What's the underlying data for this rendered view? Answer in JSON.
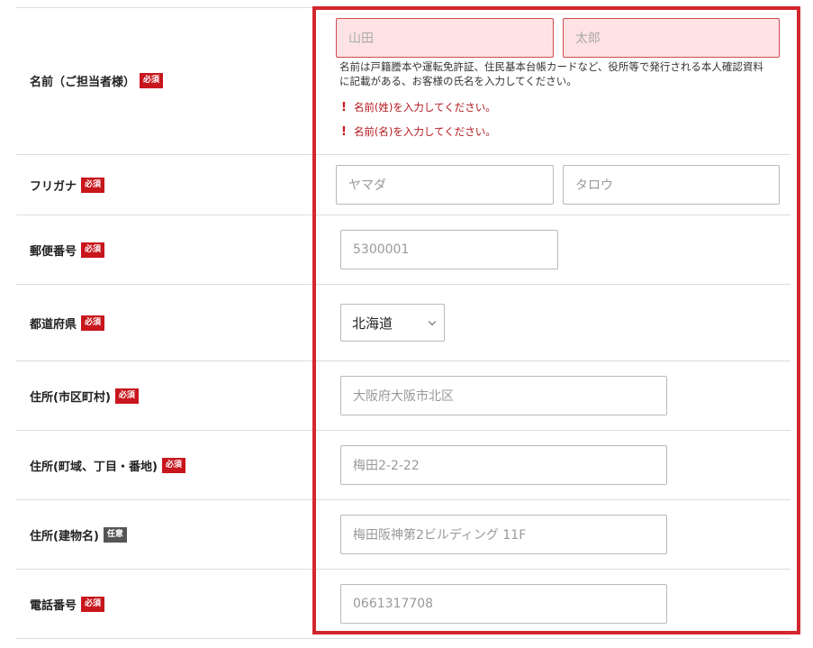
{
  "rows": {
    "name": {
      "label": "名前（ご担当者様）",
      "badge": "必須",
      "last_placeholder": "山田",
      "first_placeholder": "太郎",
      "help": "名前は戸籍謄本や運転免許証、住民基本台帳カードなど、役所等で発行される本人確認資料に記載がある、お客様の氏名を入力してください。",
      "errors": [
        "名前(姓)を入力してください。",
        "名前(名)を入力してください。"
      ]
    },
    "furigana": {
      "label": "フリガナ",
      "badge": "必須",
      "last_placeholder": "ヤマダ",
      "first_placeholder": "タロウ"
    },
    "postal": {
      "label": "郵便番号",
      "badge": "必須",
      "placeholder": "5300001"
    },
    "prefecture": {
      "label": "都道府県",
      "badge": "必須",
      "selected": "北海道"
    },
    "city": {
      "label": "住所(市区町村)",
      "badge": "必須",
      "placeholder": "大阪府大阪市北区"
    },
    "street": {
      "label": "住所(町域、丁目・番地)",
      "badge": "必須",
      "placeholder": "梅田2-2-22"
    },
    "building": {
      "label": "住所(建物名)",
      "badge": "任意",
      "placeholder": "梅田阪神第2ビルディング 11F"
    },
    "phone": {
      "label": "電話番号",
      "badge": "必須",
      "placeholder": "0661317708"
    }
  },
  "error_marker": "!",
  "colors": {
    "required_badge": "#c8161d",
    "optional_badge": "#555555",
    "error_bg": "#ffe3e4",
    "highlight": "#d3262e"
  }
}
